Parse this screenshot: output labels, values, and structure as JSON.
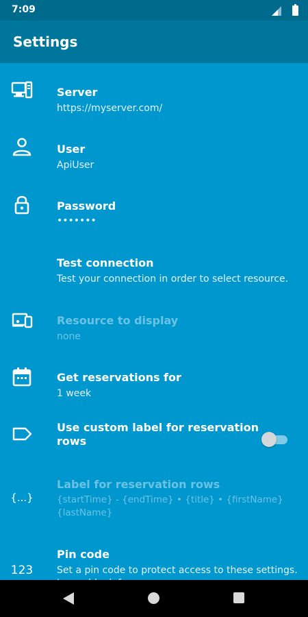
{
  "status_bar": {
    "time": "7:09"
  },
  "app_bar": {
    "title": "Settings"
  },
  "settings": {
    "server": {
      "title": "Server",
      "summary": "https://myserver.com/",
      "icon": "computer-icon"
    },
    "user": {
      "title": "User",
      "summary": "ApiUser",
      "icon": "person-icon"
    },
    "password": {
      "title": "Password",
      "summary": "•••••••",
      "icon": "lock-icon"
    },
    "test_connection": {
      "title": "Test connection",
      "summary": "Test your connection in order to select resource."
    },
    "resource": {
      "title": "Resource to display",
      "summary": "none",
      "icon": "devices-icon",
      "enabled": false
    },
    "reservations": {
      "title": "Get reservations for",
      "summary": "1 week",
      "icon": "calendar-icon"
    },
    "custom_label": {
      "title": "Use custom label for reservation rows",
      "icon": "label-icon",
      "toggle_on": false
    },
    "label_rows": {
      "title": "Label for reservation rows",
      "summary": "{startTime} - {endTime} • {title} • {firstName} {lastName}",
      "icon": "braces-icon",
      "enabled": false
    },
    "pin_code": {
      "title": "Pin code",
      "summary": "Set a pin code to protect access to these settings. Leave blank for none.",
      "icon": "numbers-icon"
    }
  },
  "colors": {
    "background": "#0097cf",
    "app_bar": "#00769c",
    "status_bar": "#006a8c"
  }
}
